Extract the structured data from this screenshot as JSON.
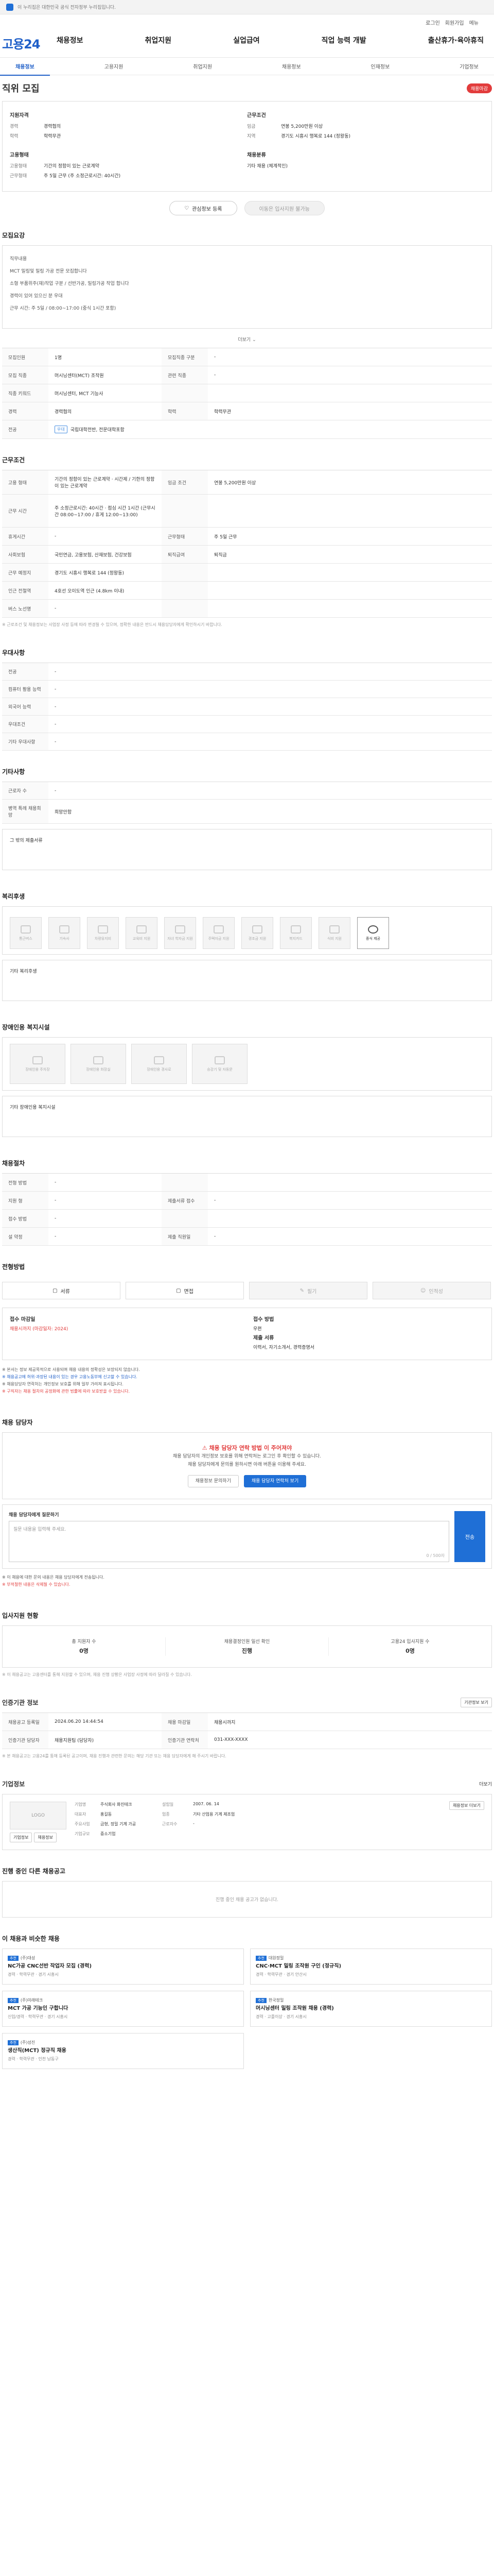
{
  "topbar": {
    "notice": "이 누리집은 대한민국 공식 전자정부 누리집입니다.",
    "right": ""
  },
  "header": {
    "logo": "고용24",
    "util": [
      "로그인",
      "회원가입",
      "메뉴"
    ],
    "gnb": [
      "채용정보",
      "취업지원",
      "실업급여",
      "직업 능력 개발",
      "출산휴가·육아휴직"
    ]
  },
  "subnav": [
    "채용정보",
    "고용지원",
    "취업지원",
    "채용정보",
    "인재정보",
    "기업정보"
  ],
  "job": {
    "section": "직위 모집",
    "status": "채용마감"
  },
  "summary": {
    "left_title": "지원자격",
    "left": [
      {
        "k": "경력",
        "v": "경력협의"
      },
      {
        "k": "학력",
        "v": "학력무관"
      }
    ],
    "right_title": "근무조건",
    "right": [
      {
        "k": "임금",
        "v": "연봉 5,200만원 이상"
      },
      {
        "k": "지역",
        "v": "경기도 시흥시 행복로 144 (정왕동)"
      }
    ],
    "left2_title": "고용형태",
    "left2": [
      {
        "k": "고용형태",
        "v": "기간의 정함이 있는 근로계약"
      },
      {
        "k": "근무형태",
        "v": "주 5일 근무 (주 소정근로시간: 40시간)"
      }
    ],
    "right2_title": "채용분류",
    "right2": [
      {
        "k": "",
        "v": "기타 채용 (체계적인)"
      }
    ],
    "btn_save": "관심정보 등록",
    "btn_apply": "이동은 입사지원 불가능"
  },
  "recruit": {
    "title": "모집요강",
    "text": [
      "직무내용",
      "MCT 밀링및 밀링 가공 전문 모집합니다",
      "소형 부품위주(재)작업 구분 / 선반가공, 밀링가공 작업 합니다",
      "경력이 있어 있으신 분 우대",
      "근무 시간: 주 5일 / 08:00~17:00 (중식 1시간 포함)"
    ],
    "more": "더보기",
    "rows": [
      [
        "모집인원",
        "1명",
        "모집직종 구분",
        "-"
      ],
      [
        "모집 직종",
        "머시닝센터(MCT) 조작원",
        "관련 직종",
        "-"
      ],
      [
        "직종 키워드",
        "머시닝센터, MCT 기능사",
        "",
        ""
      ],
      [
        "경력",
        "경력협의",
        "학력",
        "학력무관"
      ]
    ],
    "major_k": "전공",
    "major_v": "국립대학전반, 전문대학포함",
    "major_tag": "우대"
  },
  "work": {
    "title": "근무조건",
    "rows": [
      [
        "고용 형태",
        "기간의 정함이 있는 근로계약 · 시간제 / 기한의 정함이 있는 근로계약",
        "임금 조건",
        "연봉 5,200만원 이상"
      ],
      [
        "근무 시간",
        "주 소정근로시간: 40시간 · 점심 시간 1시간 (근무시간 08:00~17:00 / 휴게 12:00~13:00)",
        "",
        ""
      ],
      [
        "휴게시간",
        "-",
        "근무형태",
        "주 5일 근무"
      ],
      [
        "사회보험",
        "국민연금, 고용보험, 산재보험, 건강보험",
        "퇴직급여",
        "퇴직금"
      ],
      [
        "근무 예정지",
        "경기도 시흥시 행복로 144 (정왕동)",
        "",
        ""
      ],
      [
        "인근 전철역",
        "4호선 오이도역 인근 (4.8km 이내)",
        "",
        ""
      ],
      [
        "버스 노선명",
        "-",
        "",
        ""
      ]
    ],
    "note": "※ 근로조건 및 채용정보는 사업장 사정 등에 따라 변경될 수 있으며, 정확한 내용은 반드시 채용담당자에게 확인하시기 바랍니다."
  },
  "prefer": {
    "title": "우대사항",
    "rows": [
      [
        "전공",
        "-"
      ],
      [
        "컴퓨터 활용 능력",
        "-"
      ],
      [
        "외국어 능력",
        "-"
      ],
      [
        "우대조건",
        "-"
      ],
      [
        "기타 우대사항",
        "-"
      ]
    ]
  },
  "other": {
    "title": "기타사항",
    "rows": [
      [
        "근로자 수",
        "-"
      ],
      [
        "병역 특례 채용희망",
        "희망안함"
      ]
    ],
    "box_label": "그 밖의 제출서류"
  },
  "welfare": {
    "title": "복리후생",
    "items": [
      "통근버스",
      "기숙사",
      "차량유지비",
      "교육비 지원",
      "자녀 학자금 지원",
      "주택자금 지원",
      "경조금 지원",
      "복지카드",
      "식비 지원",
      "중식 제공"
    ],
    "extra_label": "기타 복리후생"
  },
  "disab": {
    "title": "장애인용 복지시설",
    "items": [
      "장애인용 주차장",
      "장애인용 화장실",
      "장애인용 경사로",
      "승강기 및 자동문"
    ],
    "extra_label": "기타 장애인용 복지시설"
  },
  "screening": {
    "title": "채용절차",
    "rows": [
      [
        "전형 방법",
        "-",
        "",
        ""
      ],
      [
        "지원 형",
        "-",
        "제출서류 접수",
        "-"
      ],
      [
        "접수 방법",
        "-",
        "",
        ""
      ],
      [
        "설 약정",
        "-",
        "제출 직원일",
        "-"
      ]
    ]
  },
  "apply_method": {
    "title": "전형방법",
    "buttons": [
      "서류",
      "면접",
      "필기",
      "인적성"
    ]
  },
  "contact": {
    "col1_label": "접수 마감일",
    "col1_value": "채용시까지 (마감일자: 2024)",
    "col2_label": "접수 방법",
    "col2_value": "우편",
    "col3_label": "제출 서류",
    "col3_value": "이력서, 자기소개서, 경력증명서"
  },
  "notes": [
    "※ 본서는 정보 제공목적으로 사용되며 채용 내용의 정확성은 보장되지 않습니다.",
    "※ 채용공고에 허위·과장된 내용이 있는 경우 고용노동부에 신고할 수 있습니다.",
    "※ 채용담당자 연락처는 개인정보 보호를 위해 일부 가려져 표시됩니다.",
    "※ 구직자는 채용 절차의 공정화에 관한 법률에 따라 보호받을 수 있습니다."
  ],
  "manager": {
    "title": "채용 담당자",
    "alert_title": "채용 담당자 연락 방법 이 주어져야",
    "alert_text": "채용 담당자의 개인정보 보호를 위해 연락처는 로그인 후 확인할 수 있습니다.",
    "alert_text2": "채용 담당자에게 문의를 원하시면 아래 버튼을 이용해 주세요.",
    "btn1": "채용정보 문의하기",
    "btn2": "채용 담당자 연락처 보기",
    "inq_label": "채용 담당자에게 질문하기",
    "inq_placeholder": "질문 내용을 입력해 주세요.",
    "inq_count": "0 / 500자",
    "inq_btn": "전송",
    "inq_note1": "※ 이 채용에 대한 문의 내용은 채용 담당자에게 전송됩니다.",
    "inq_note2": "※ 부적절한 내용은 삭제될 수 있습니다."
  },
  "status": {
    "title": "입사지원 현황",
    "cols": [
      {
        "label": "총 지원자 수",
        "value": "0명"
      },
      {
        "label": "채용결정인원 일선 확인",
        "value": "진행"
      },
      {
        "label": "고용24 입사지원 수",
        "value": "0명"
      }
    ],
    "note": "※ 이 채용공고는 고용센터를 통해 지원할 수 있으며, 채용 진행 상황은 사업장 사정에 따라 달라질 수 있습니다."
  },
  "agency": {
    "title": "인증기관 정보",
    "btn": "기관정보 보기",
    "rows": [
      [
        "채용공고 등록일",
        "2024.06.20 14:44:54",
        "채용 마감일",
        "채용시까지"
      ],
      [
        "인증기관 담당자",
        "채용지원팀 (담당자)",
        "인증기관 연락처",
        "031-XXX-XXXX"
      ]
    ],
    "note": "※ 본 채용공고는 고용24를 통해 등록된 공고이며, 채용 진행과 관련한 문의는 해당 기관 또는 채용 담당자에게 해 주시기 바랍니다."
  },
  "company": {
    "title": "기업정보",
    "more": "더보기",
    "logo_text": "LOGO",
    "btn1": "기업정보",
    "btn2": "채용정보",
    "info": [
      [
        "기업명",
        "주식회사 화진테크",
        "설립일",
        "2007. 06. 14"
      ],
      [
        "대표자",
        "홍길동",
        "업종",
        "기타 산업용 기계 제조업"
      ],
      [
        "주요사업",
        "금형, 정밀 기계 가공",
        "근로자수",
        "-"
      ],
      [
        "기업규모",
        "중소기업",
        "",
        ""
      ]
    ],
    "btn3": "채용정보 더보기"
  },
  "others": {
    "title": "진행 중인 다른 채용공고",
    "empty": "진행 중인 채용 공고가 없습니다."
  },
  "recommend": {
    "title": "이 채용과 비슷한 채용",
    "items": [
      {
        "badge": "추천",
        "name": "(주)대성",
        "title": "NC가공 CNC선반 작업자 모집 (경력)",
        "meta": "경력 · 학력무관 · 경기 시흥시"
      },
      {
        "badge": "추천",
        "name": "대원정밀",
        "title": "CNC·MCT 밀링 조작원 구인 (정규직)",
        "meta": "경력 · 학력무관 · 경기 안산시"
      },
      {
        "badge": "추천",
        "name": "(주)미래테크",
        "title": "MCT 가공 기능인 구합니다",
        "meta": "신입/경력 · 학력무관 · 경기 시흥시"
      },
      {
        "badge": "추천",
        "name": "한국정밀",
        "title": "머시닝센터 밀링 조작원 채용 (경력)",
        "meta": "경력 · 고졸이상 · 경기 시흥시"
      },
      {
        "badge": "추천",
        "name": "(주)성진",
        "title": "생산직(MCT) 정규직 채용",
        "meta": "경력 · 학력무관 · 인천 남동구"
      }
    ]
  }
}
